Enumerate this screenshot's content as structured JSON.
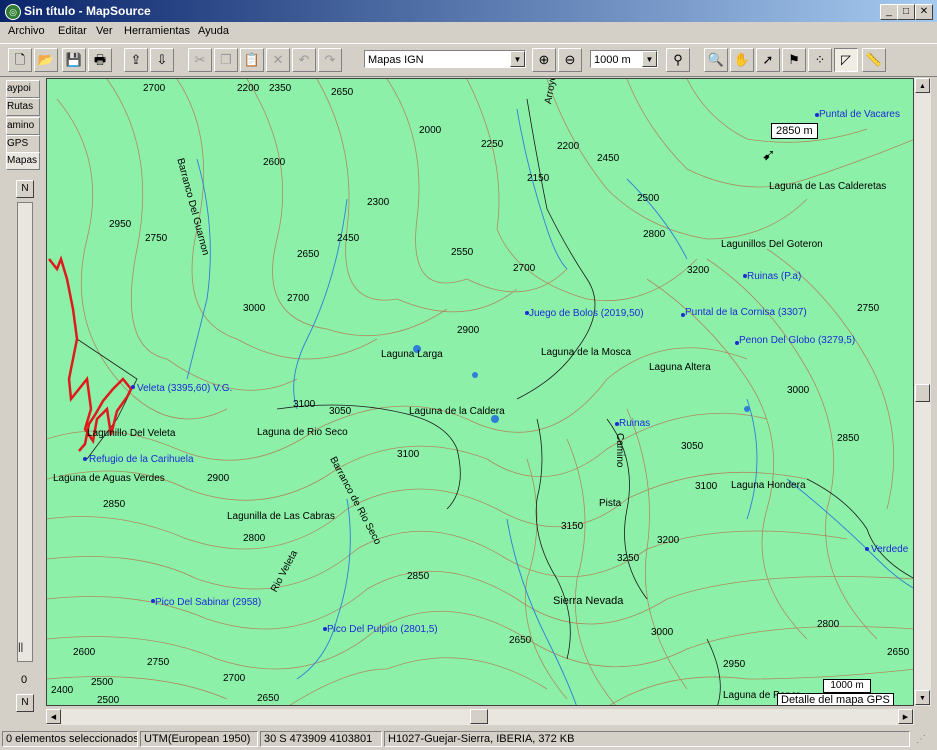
{
  "window": {
    "title": "Sin título - MapSource"
  },
  "menu": [
    "Archivo",
    "Editar",
    "Ver",
    "Herramientas",
    "Ayuda"
  ],
  "toolbar": {
    "map_product": "Mapas IGN",
    "zoom_scale": "1000 m"
  },
  "side_tabs": [
    "aypoi",
    "Rutas",
    "amino",
    "GPS",
    "Mapas"
  ],
  "side_panel": {
    "top_button": "N",
    "bottom_button": "N",
    "counter": "0"
  },
  "map": {
    "cursor_elevation": "2850 m",
    "scale_label": "1000 m",
    "detail_label": "Detalle del mapa GPS",
    "labels_black": [
      "Barranco Del Guarnon",
      "Laguna de Las Calderetas",
      "Lagunillos Del Goteron",
      "Laguna Larga",
      "Laguna de la Mosca",
      "Laguna Altera",
      "Laguna de la Caldera",
      "Lagunillo Del Veleta",
      "Laguna de Rio Seco",
      "Laguna de Aguas Verdes",
      "Lagunilla de Las Cabras",
      "Barranco de Rio Seco",
      "Rio Veleta",
      "Sierra Nevada",
      "Laguna Hondera",
      "Camino",
      "Pista",
      "Arroyo",
      "Laguna de Penor"
    ],
    "labels_blue": [
      "Puntal de Vacares",
      "Ruinas (P.a)",
      "Juego de Bolos (2019,50)",
      "Puntal de la Cornisa (3307)",
      "Penon Del Globo (3279,5)",
      "Veleta (3395,60) V.G.",
      "Refugio de la Carihuela",
      "Ruinas",
      "Pico Del Sabinar (2958)",
      "Pico Del Pulpito (2801,5)",
      "Verdede"
    ],
    "contour_labels": [
      "2700",
      "2200",
      "2350",
      "2650",
      "2000",
      "2250",
      "2150",
      "2200",
      "2450",
      "2500",
      "2750",
      "2600",
      "2950",
      "2300",
      "2450",
      "2650",
      "2550",
      "2700",
      "2800",
      "3000",
      "2700",
      "2900",
      "3100",
      "3050",
      "3100",
      "3200",
      "2750",
      "3000",
      "2850",
      "3050",
      "3100",
      "3250",
      "3200",
      "3150",
      "2900",
      "2850",
      "2800",
      "2800",
      "2600",
      "2500",
      "2750",
      "2700",
      "2650",
      "2650",
      "3000",
      "2950",
      "2850",
      "2650",
      "2400",
      "2500"
    ]
  },
  "status": {
    "selection": "0 elementos seleccionados",
    "datum": "UTM(European 1950)",
    "position": "30 S 473909 4103801",
    "mapset": "H1027-Guejar-Sierra, IBERIA, 372 KB"
  }
}
